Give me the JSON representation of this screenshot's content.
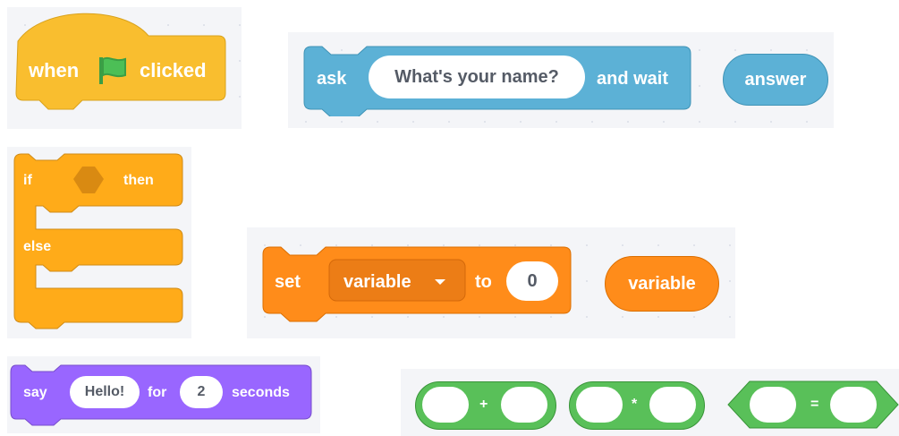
{
  "colors": {
    "events": "#f9be2f",
    "sensing": "#5cb1d6",
    "control": "#ffab19",
    "variables": "#ff8c1a",
    "looks": "#9966ff",
    "operators": "#59c059",
    "flag": "#4cbf56",
    "panel": "#f4f5f8"
  },
  "event_block": {
    "when": "when",
    "clicked": "clicked",
    "icon": "green-flag-icon"
  },
  "ask_block": {
    "ask": "ask",
    "question": "What's your name?",
    "and_wait": "and wait"
  },
  "answer_reporter": {
    "label": "answer"
  },
  "if_else_block": {
    "if_label": "if",
    "then_label": "then",
    "else_label": "else"
  },
  "set_block": {
    "set": "set",
    "variable": "variable",
    "to": "to",
    "value": "0"
  },
  "variable_reporter": {
    "label": "variable"
  },
  "say_block": {
    "say": "say",
    "message": "Hello!",
    "for": "for",
    "seconds_value": "2",
    "seconds": "seconds"
  },
  "operators": {
    "plus": "+",
    "times": "*",
    "equals": "="
  }
}
